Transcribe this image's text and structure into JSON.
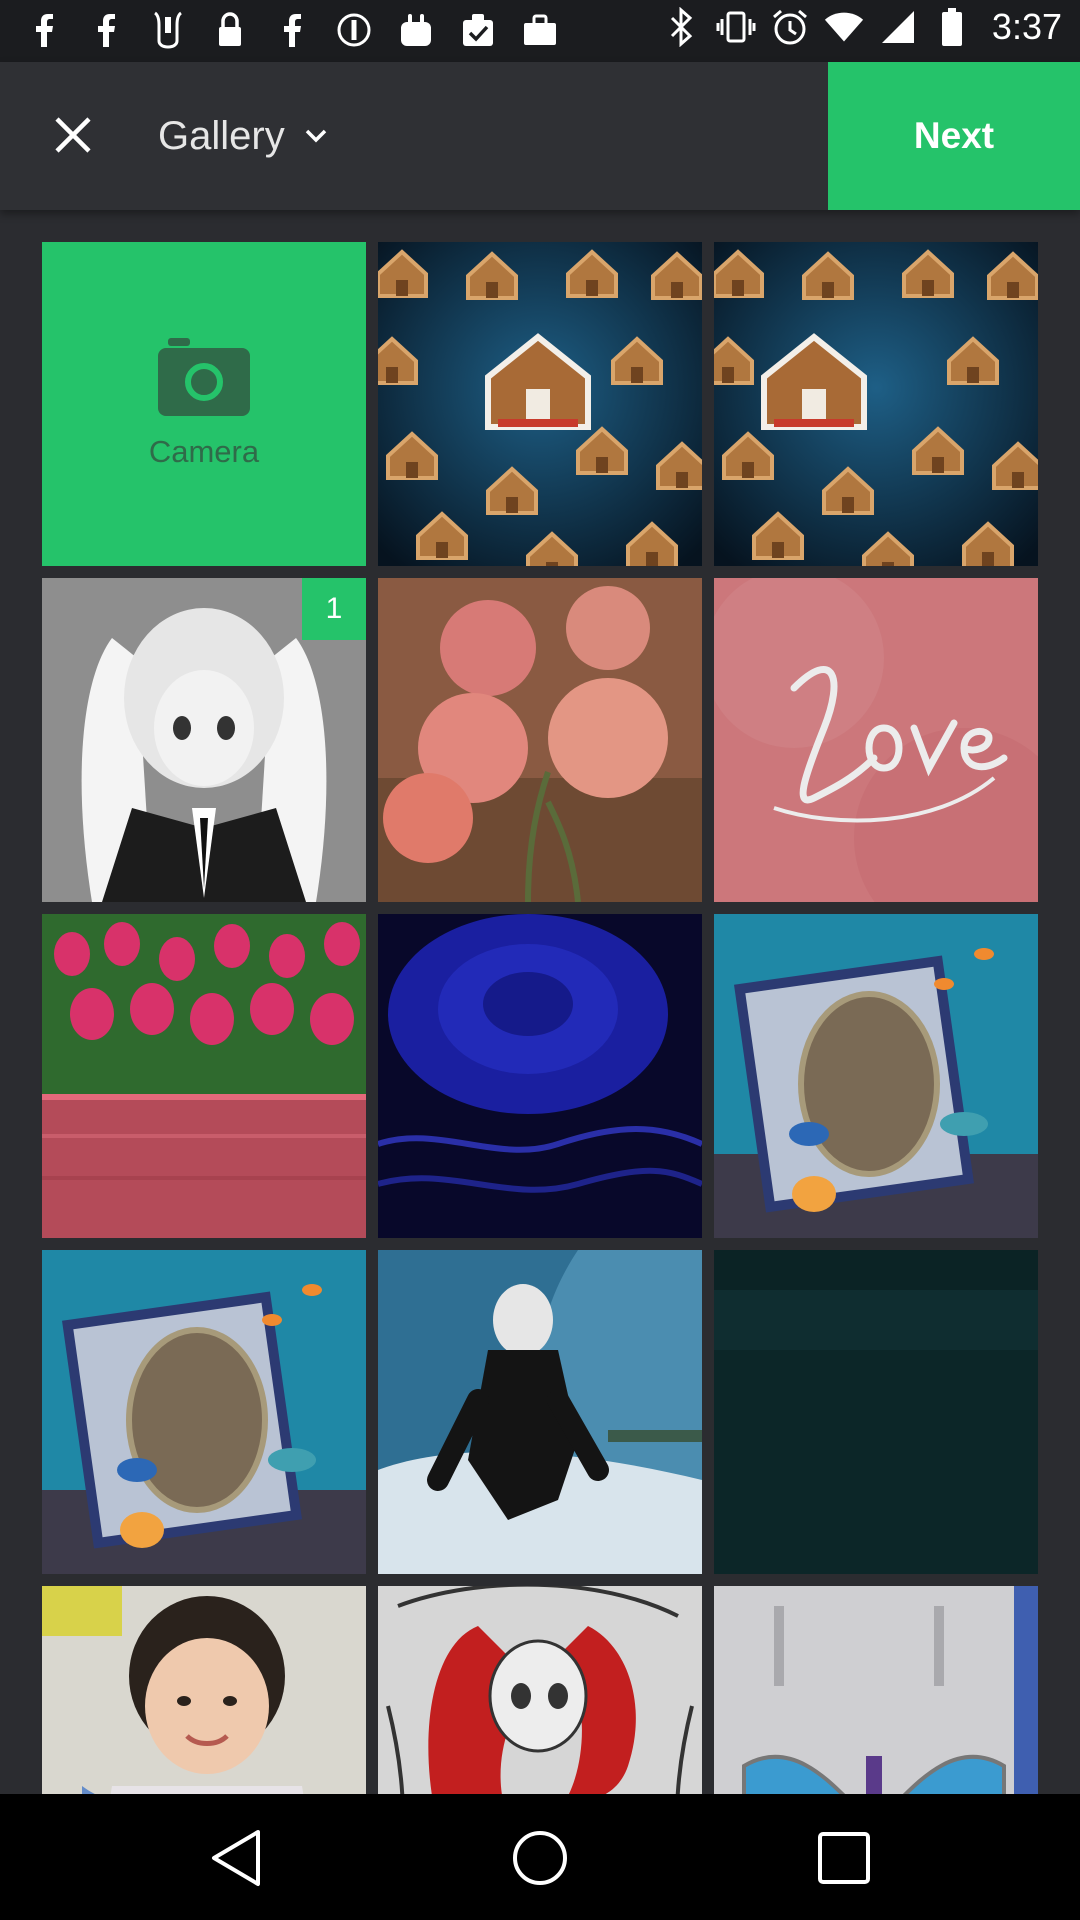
{
  "status_bar": {
    "time": "3:37",
    "left_icons": [
      "facebook-icon",
      "facebook-icon",
      "mobile-app-icon",
      "lock-icon",
      "facebook-icon",
      "settings-alert-icon",
      "shopping-bag-icon",
      "checkbox-icon",
      "briefcase-icon"
    ],
    "right_icons": [
      "bluetooth-icon",
      "vibrate-icon",
      "alarm-icon",
      "wifi-icon",
      "signal-icon",
      "battery-icon"
    ]
  },
  "header": {
    "close_icon": "close-icon",
    "title": "Gallery",
    "dropdown_icon": "chevron-down-icon",
    "next_label": "Next",
    "accent_color": "#25c36a"
  },
  "grid": {
    "camera_label": "Camera",
    "camera_icon": "camera-icon",
    "selected_badge": "1",
    "thumbnails": [
      {
        "name": "gingerbread-houses-1"
      },
      {
        "name": "gingerbread-houses-2"
      },
      {
        "name": "anime-girl"
      },
      {
        "name": "pink-roses"
      },
      {
        "name": "love-script"
      },
      {
        "name": "tulip-field"
      },
      {
        "name": "blue-rose"
      },
      {
        "name": "aquarium-frame-1"
      },
      {
        "name": "aquarium-frame-2"
      },
      {
        "name": "surfer"
      },
      {
        "name": "dark-teal"
      },
      {
        "name": "child-portrait"
      },
      {
        "name": "mermaid-drawing"
      },
      {
        "name": "hourglass-screen"
      }
    ]
  },
  "nav_bar": {
    "back_icon": "back-icon",
    "home_icon": "home-icon",
    "recents_icon": "recents-icon"
  }
}
